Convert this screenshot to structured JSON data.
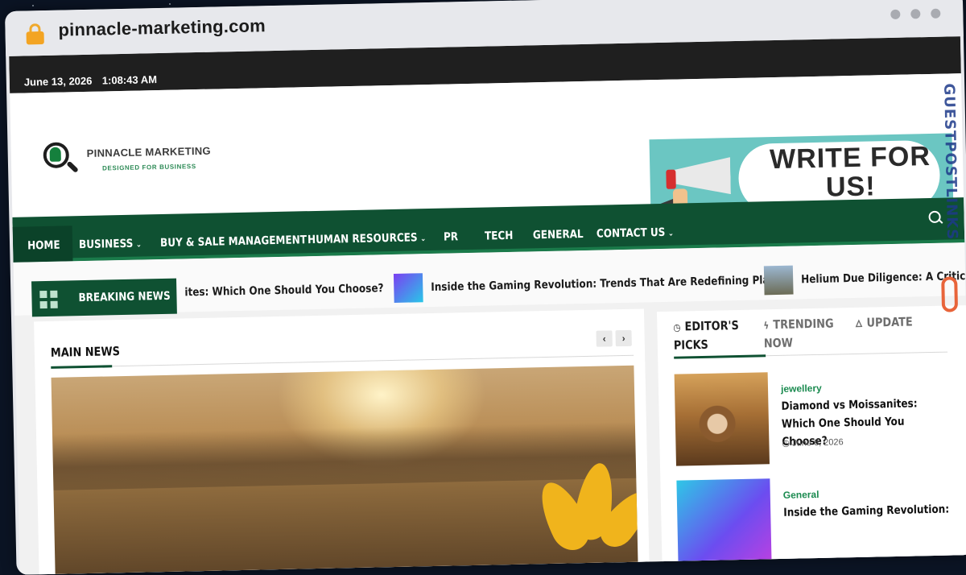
{
  "browser": {
    "url": "pinnacle-marketing.com"
  },
  "topbar": {
    "date": "June 13, 2026",
    "time": "1:08:43 AM"
  },
  "logo": {
    "title": "PINNACLE MARKETING",
    "tagline": "DESIGNED FOR BUSINESS"
  },
  "banner": {
    "text_line1": "WRITE FOR",
    "text_line2": "US!"
  },
  "nav": {
    "items": [
      {
        "label": "HOME",
        "dropdown": false
      },
      {
        "label": "BUSINESS",
        "dropdown": true
      },
      {
        "label": "BUY & SALE MANAGEMENT",
        "dropdown": false
      },
      {
        "label": "HUMAN RESOURCES",
        "dropdown": true
      },
      {
        "label": "PR",
        "dropdown": false
      },
      {
        "label": "TECH",
        "dropdown": false
      },
      {
        "label": "GENERAL",
        "dropdown": false
      },
      {
        "label": "CONTACT US",
        "dropdown": true
      }
    ],
    "chevron": "⌄",
    "search_icon": "search-icon"
  },
  "breaking": {
    "label": "BREAKING NEWS",
    "items": [
      "ites: Which One Should You Choose?",
      "Inside the Gaming Revolution: Trends That Are Redefining Play",
      "Helium Due Diligence: A Critica"
    ]
  },
  "main_news": {
    "title": "MAIN NEWS",
    "prev": "‹",
    "next": "›"
  },
  "sidebar": {
    "tabs": [
      {
        "icon": "clock-icon",
        "glyph": "◷",
        "line1": "EDITOR'S",
        "line2": "PICKS"
      },
      {
        "icon": "bolt-icon",
        "glyph": "ϟ",
        "line1": "TRENDING",
        "line2": "NOW"
      },
      {
        "icon": "fire-icon",
        "glyph": "🜂",
        "line1": "UPDATE",
        "line2": ""
      }
    ],
    "cards": [
      {
        "category": "jewellery",
        "title": "Diamond vs Moissanites: Which One Should You Choose?",
        "date": "June 6, 2026"
      },
      {
        "category": "General",
        "title": "Inside the Gaming Revolution:",
        "date": ""
      }
    ]
  },
  "watermark": {
    "text": "GUESTPOSTLINKS"
  },
  "colors": {
    "brand_green": "#0f5132",
    "accent_green": "#1a8a4f",
    "topbar": "#1f1f1f"
  }
}
